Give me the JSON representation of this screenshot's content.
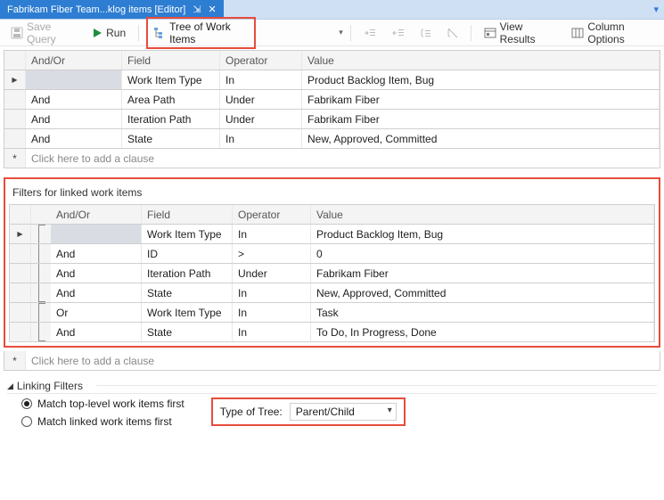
{
  "title": {
    "tab": "Fabrikam Fiber Team...klog items [Editor]"
  },
  "toolbar": {
    "save_query": "Save Query",
    "run": "Run",
    "tree_mode": "Tree of Work Items",
    "view_results": "View Results",
    "column_options": "Column Options"
  },
  "grid": {
    "headers": {
      "andor": "And/Or",
      "field": "Field",
      "operator": "Operator",
      "value": "Value"
    },
    "rows": [
      {
        "andor": "",
        "field": "Work Item Type",
        "operator": "In",
        "value": "Product Backlog Item, Bug"
      },
      {
        "andor": "And",
        "field": "Area Path",
        "operator": "Under",
        "value": "Fabrikam Fiber"
      },
      {
        "andor": "And",
        "field": "Iteration Path",
        "operator": "Under",
        "value": "Fabrikam Fiber"
      },
      {
        "andor": "And",
        "field": "State",
        "operator": "In",
        "value": "New, Approved, Committed"
      }
    ],
    "add_text": "Click here to add a clause"
  },
  "linked": {
    "title": "Filters for linked work items",
    "headers": {
      "andor": "And/Or",
      "field": "Field",
      "operator": "Operator",
      "value": "Value"
    },
    "rows": [
      {
        "andor": "",
        "field": "Work Item Type",
        "operator": "In",
        "value": "Product Backlog Item, Bug"
      },
      {
        "andor": "And",
        "field": "ID",
        "operator": ">",
        "value": "0"
      },
      {
        "andor": "And",
        "field": "Iteration Path",
        "operator": "Under",
        "value": "Fabrikam Fiber"
      },
      {
        "andor": "And",
        "field": "State",
        "operator": "In",
        "value": "New, Approved, Committed"
      },
      {
        "andor": "Or",
        "field": "Work Item Type",
        "operator": "In",
        "value": "Task"
      },
      {
        "andor": "And",
        "field": "State",
        "operator": "In",
        "value": "To Do, In Progress, Done"
      }
    ],
    "add_text": "Click here to add a clause"
  },
  "linking": {
    "header": "Linking Filters",
    "radio1": "Match top-level work items first",
    "radio2": "Match linked work items first",
    "type_label": "Type of Tree:",
    "type_value": "Parent/Child"
  }
}
